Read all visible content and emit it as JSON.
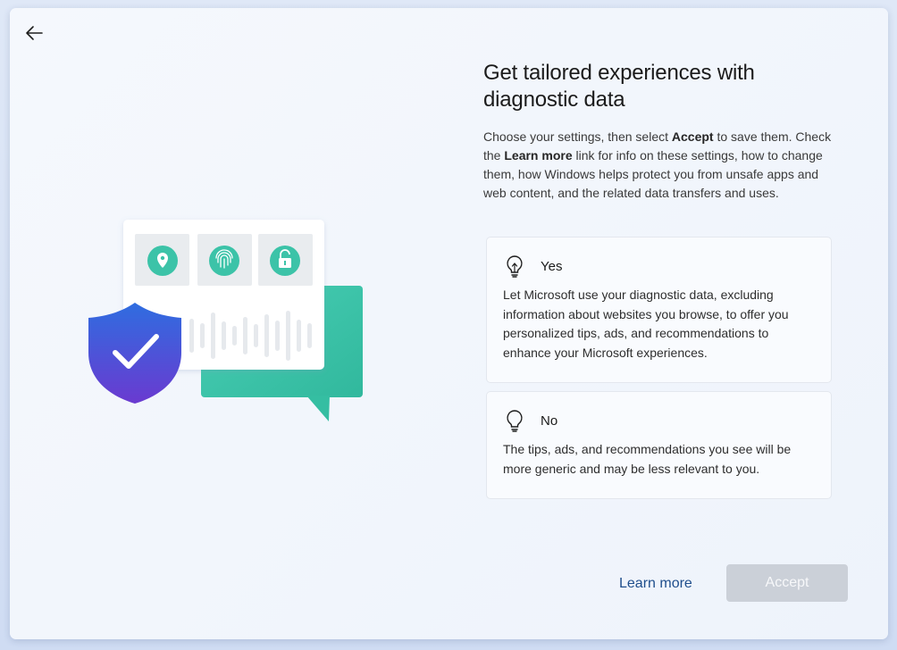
{
  "header": {
    "back_icon": "arrow-left-icon"
  },
  "main": {
    "title": "Get tailored experiences with diagnostic data",
    "description_parts": {
      "p1": "Choose your settings, then select ",
      "accept_bold": "Accept",
      "p2": " to save them. Check the ",
      "learn_more_bold": "Learn more",
      "p3": " link for info on these settings, how to change them, how Windows helps protect you from unsafe apps and web content, and the related data transfers and uses."
    }
  },
  "options": [
    {
      "title": "Yes",
      "icon": "lightbulb-on-icon",
      "description": "Let Microsoft use your diagnostic data, excluding information about websites you browse, to offer you personalized tips, ads, and recommendations to enhance your Microsoft experiences."
    },
    {
      "title": "No",
      "icon": "lightbulb-off-icon",
      "description": "The tips, ads, and recommendations you see will be more generic and may be less relevant to you."
    }
  ],
  "footer": {
    "learn_more_label": "Learn more",
    "accept_label": "Accept"
  },
  "illustration": {
    "icons": [
      "location-pin-icon",
      "fingerprint-icon",
      "unlock-icon",
      "shield-check-icon",
      "chat-bubble-icon"
    ],
    "colors": {
      "teal": "#3cc3a8",
      "shield_top": "#2f6de0",
      "shield_bottom": "#6a3ad0"
    }
  }
}
